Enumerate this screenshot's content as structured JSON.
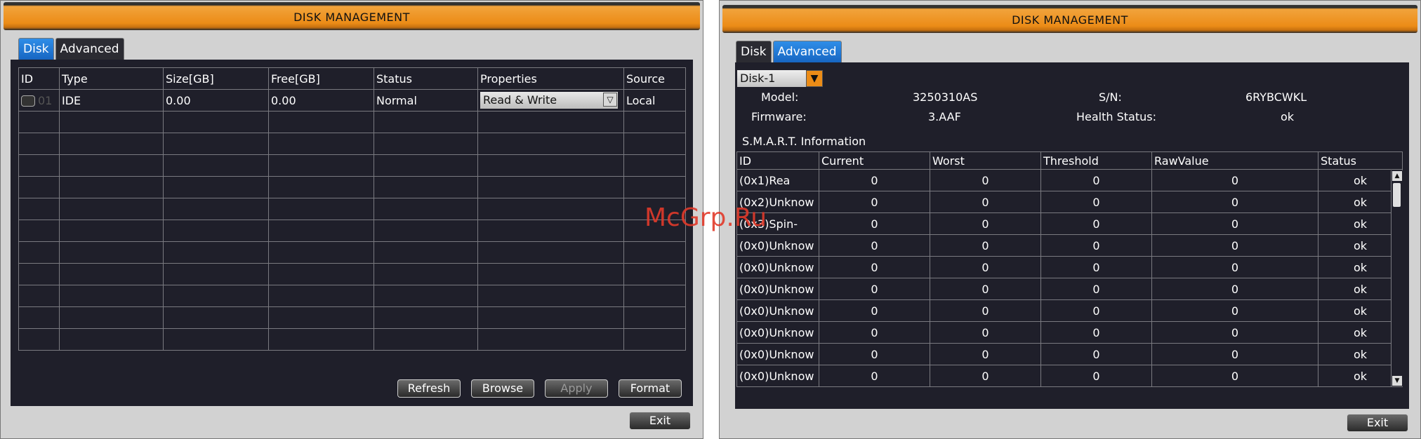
{
  "left": {
    "title": "DISK MANAGEMENT",
    "tabs": [
      "Disk",
      "Advanced"
    ],
    "columns": [
      "ID",
      "Type",
      "Size[GB]",
      "Free[GB]",
      "Status",
      "Properties",
      "Source"
    ],
    "row": {
      "id": "01",
      "type": "IDE",
      "size": "0.00",
      "free": "0.00",
      "status": "Normal",
      "properties": "Read & Write",
      "source": "Local"
    },
    "buttons": {
      "refresh": "Refresh",
      "browse": "Browse",
      "apply": "Apply",
      "format": "Format",
      "exit": "Exit"
    }
  },
  "right": {
    "title": "DISK MANAGEMENT",
    "tabs": [
      "Disk",
      "Advanced"
    ],
    "disk_select": "Disk-1",
    "model_label": "Model:",
    "model_value": "3250310AS",
    "sn_label": "S/N:",
    "sn_value": "6RYBCWKL",
    "firmware_label": "Firmware:",
    "firmware_value": "3.AAF",
    "health_label": "Health Status:",
    "health_value": "ok",
    "smart_title": "S.M.A.R.T. Information",
    "columns": [
      "ID",
      "Current",
      "Worst",
      "Threshold",
      "RawValue",
      "Status"
    ],
    "rows": [
      [
        "(0x1)Rea",
        "0",
        "0",
        "0",
        "0",
        "ok"
      ],
      [
        "(0x2)Unknow",
        "0",
        "0",
        "0",
        "0",
        "ok"
      ],
      [
        "(0x3)Spin-",
        "0",
        "0",
        "0",
        "0",
        "ok"
      ],
      [
        "(0x0)Unknow",
        "0",
        "0",
        "0",
        "0",
        "ok"
      ],
      [
        "(0x0)Unknow",
        "0",
        "0",
        "0",
        "0",
        "ok"
      ],
      [
        "(0x0)Unknow",
        "0",
        "0",
        "0",
        "0",
        "ok"
      ],
      [
        "(0x0)Unknow",
        "0",
        "0",
        "0",
        "0",
        "ok"
      ],
      [
        "(0x0)Unknow",
        "0",
        "0",
        "0",
        "0",
        "ok"
      ],
      [
        "(0x0)Unknow",
        "0",
        "0",
        "0",
        "0",
        "ok"
      ],
      [
        "(0x0)Unknow",
        "0",
        "0",
        "0",
        "0",
        "ok"
      ]
    ],
    "exit": "Exit"
  },
  "watermark": "McGrp.Ru"
}
